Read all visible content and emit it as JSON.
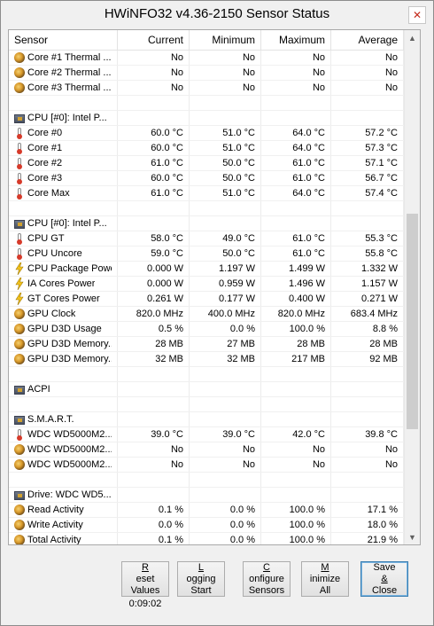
{
  "window": {
    "title": "HWiNFO32 v4.36-2150 Sensor Status"
  },
  "columns": [
    "Sensor",
    "Current",
    "Minimum",
    "Maximum",
    "Average"
  ],
  "rows": [
    {
      "icon": "sensor-icon",
      "name": "Core #1 Thermal ...",
      "cur": "No",
      "min": "No",
      "max": "No",
      "avg": "No"
    },
    {
      "icon": "sensor-icon",
      "name": "Core #2 Thermal ...",
      "cur": "No",
      "min": "No",
      "max": "No",
      "avg": "No"
    },
    {
      "icon": "sensor-icon",
      "name": "Core #3 Thermal ...",
      "cur": "No",
      "min": "No",
      "max": "No",
      "avg": "No"
    },
    {
      "icon": "",
      "name": "",
      "cur": "",
      "min": "",
      "max": "",
      "avg": ""
    },
    {
      "icon": "chip-icon",
      "name": "CPU [#0]: Intel P...",
      "cur": "",
      "min": "",
      "max": "",
      "avg": ""
    },
    {
      "icon": "thermometer-icon",
      "name": "Core #0",
      "cur": "60.0 °C",
      "min": "51.0 °C",
      "max": "64.0 °C",
      "avg": "57.2 °C"
    },
    {
      "icon": "thermometer-icon",
      "name": "Core #1",
      "cur": "60.0 °C",
      "min": "51.0 °C",
      "max": "64.0 °C",
      "avg": "57.3 °C"
    },
    {
      "icon": "thermometer-icon",
      "name": "Core #2",
      "cur": "61.0 °C",
      "min": "50.0 °C",
      "max": "61.0 °C",
      "avg": "57.1 °C"
    },
    {
      "icon": "thermometer-icon",
      "name": "Core #3",
      "cur": "60.0 °C",
      "min": "50.0 °C",
      "max": "61.0 °C",
      "avg": "56.7 °C"
    },
    {
      "icon": "thermometer-icon",
      "name": "Core Max",
      "cur": "61.0 °C",
      "min": "51.0 °C",
      "max": "64.0 °C",
      "avg": "57.4 °C"
    },
    {
      "icon": "",
      "name": "",
      "cur": "",
      "min": "",
      "max": "",
      "avg": ""
    },
    {
      "icon": "chip-icon",
      "name": "CPU [#0]: Intel P...",
      "cur": "",
      "min": "",
      "max": "",
      "avg": ""
    },
    {
      "icon": "thermometer-icon",
      "name": "CPU GT",
      "cur": "58.0 °C",
      "min": "49.0 °C",
      "max": "61.0 °C",
      "avg": "55.3 °C"
    },
    {
      "icon": "thermometer-icon",
      "name": "CPU Uncore",
      "cur": "59.0 °C",
      "min": "50.0 °C",
      "max": "61.0 °C",
      "avg": "55.8 °C"
    },
    {
      "icon": "lightning-icon",
      "name": "CPU Package Power",
      "cur": "0.000 W",
      "min": "1.197 W",
      "max": "1.499 W",
      "avg": "1.332 W"
    },
    {
      "icon": "lightning-icon",
      "name": "IA Cores Power",
      "cur": "0.000 W",
      "min": "0.959 W",
      "max": "1.496 W",
      "avg": "1.157 W"
    },
    {
      "icon": "lightning-icon",
      "name": "GT Cores Power",
      "cur": "0.261 W",
      "min": "0.177 W",
      "max": "0.400 W",
      "avg": "0.271 W"
    },
    {
      "icon": "sensor-icon",
      "name": "GPU Clock",
      "cur": "820.0 MHz",
      "min": "400.0 MHz",
      "max": "820.0 MHz",
      "avg": "683.4 MHz"
    },
    {
      "icon": "sensor-icon",
      "name": "GPU D3D Usage",
      "cur": "0.5 %",
      "min": "0.0 %",
      "max": "100.0 %",
      "avg": "8.8 %"
    },
    {
      "icon": "sensor-icon",
      "name": "GPU D3D Memory...",
      "cur": "28 MB",
      "min": "27 MB",
      "max": "28 MB",
      "avg": "28 MB"
    },
    {
      "icon": "sensor-icon",
      "name": "GPU D3D Memory...",
      "cur": "32 MB",
      "min": "32 MB",
      "max": "217 MB",
      "avg": "92 MB"
    },
    {
      "icon": "",
      "name": "",
      "cur": "",
      "min": "",
      "max": "",
      "avg": ""
    },
    {
      "icon": "chip-icon",
      "name": "ACPI",
      "cur": "",
      "min": "",
      "max": "",
      "avg": ""
    },
    {
      "icon": "",
      "name": "",
      "cur": "",
      "min": "",
      "max": "",
      "avg": ""
    },
    {
      "icon": "chip-icon",
      "name": "S.M.A.R.T.",
      "cur": "",
      "min": "",
      "max": "",
      "avg": ""
    },
    {
      "icon": "thermometer-icon",
      "name": "WDC WD5000M2...",
      "cur": "39.0 °C",
      "min": "39.0 °C",
      "max": "42.0 °C",
      "avg": "39.8 °C"
    },
    {
      "icon": "sensor-icon",
      "name": "WDC WD5000M2...",
      "cur": "No",
      "min": "No",
      "max": "No",
      "avg": "No"
    },
    {
      "icon": "sensor-icon",
      "name": "WDC WD5000M2...",
      "cur": "No",
      "min": "No",
      "max": "No",
      "avg": "No"
    },
    {
      "icon": "",
      "name": "",
      "cur": "",
      "min": "",
      "max": "",
      "avg": ""
    },
    {
      "icon": "chip-icon",
      "name": "Drive: WDC WD5...",
      "cur": "",
      "min": "",
      "max": "",
      "avg": ""
    },
    {
      "icon": "sensor-icon",
      "name": "Read Activity",
      "cur": "0.1 %",
      "min": "0.0 %",
      "max": "100.0 %",
      "avg": "17.1 %"
    },
    {
      "icon": "sensor-icon",
      "name": "Write Activity",
      "cur": "0.0 %",
      "min": "0.0 %",
      "max": "100.0 %",
      "avg": "18.0 %"
    },
    {
      "icon": "sensor-icon",
      "name": "Total Activity",
      "cur": "0.1 %",
      "min": "0.0 %",
      "max": "100.0 %",
      "avg": "21.9 %"
    }
  ],
  "buttons": {
    "reset": {
      "line1_u": "R",
      "line1": "eset",
      "line2": "Values"
    },
    "logging": {
      "line1_u": "L",
      "line1": "ogging",
      "line2": "Start"
    },
    "configure": {
      "line1_u": "C",
      "line1": "onfigure",
      "line2": "Sensors"
    },
    "minimize": {
      "line1_u": "M",
      "line1": "inimize",
      "line2": "All"
    },
    "save": {
      "line1": "Save",
      "line2_u": "&",
      "line2": " Close"
    }
  },
  "timer": "0:09:02",
  "colors": {
    "accent": "#3c7fb1",
    "close": "#c42b1c",
    "thumb": "#cdcdcd"
  }
}
